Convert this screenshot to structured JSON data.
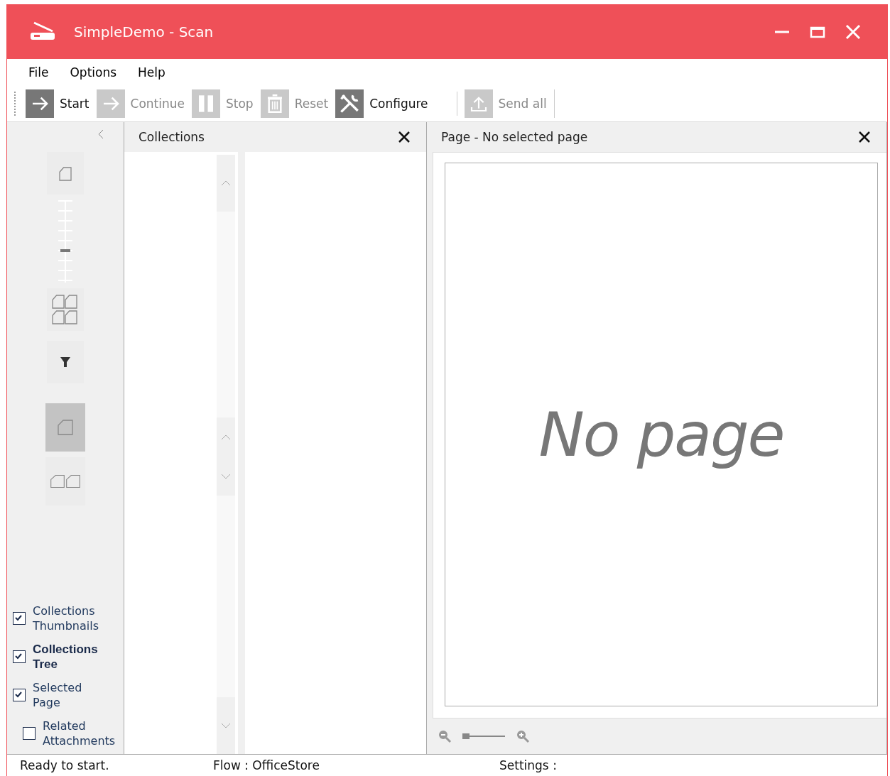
{
  "window": {
    "title": "SimpleDemo - Scan"
  },
  "menu": [
    "File",
    "Options",
    "Help"
  ],
  "toolbar": [
    {
      "label": "Start",
      "disabled": false
    },
    {
      "label": "Continue",
      "disabled": true
    },
    {
      "label": "Stop",
      "disabled": true
    },
    {
      "label": "Reset",
      "disabled": true
    },
    {
      "label": "Configure",
      "disabled": false
    },
    {
      "label": "Send all",
      "disabled": true
    }
  ],
  "sidebar": {
    "size_slider": {
      "level": 0.37
    },
    "views": [
      {
        "kind": "single",
        "selected": true
      },
      {
        "kind": "double",
        "selected": false
      }
    ],
    "toggles": [
      {
        "label": "Collections Thumbnails",
        "checked": true,
        "highlighted": false
      },
      {
        "label": "Collections Tree",
        "checked": true,
        "highlighted": true
      },
      {
        "label": "Selected Page",
        "checked": true,
        "highlighted": false
      },
      {
        "label": "Related Attachments",
        "checked": false,
        "highlighted": false
      }
    ]
  },
  "collections_panel": {
    "title": "Collections"
  },
  "page_panel": {
    "title": "Page - No selected page",
    "placeholder_text": "No page",
    "zoom": {
      "level": 0
    }
  },
  "status_bar": [
    "Ready to start.",
    "Flow : OfficeStore",
    "Settings :"
  ]
}
